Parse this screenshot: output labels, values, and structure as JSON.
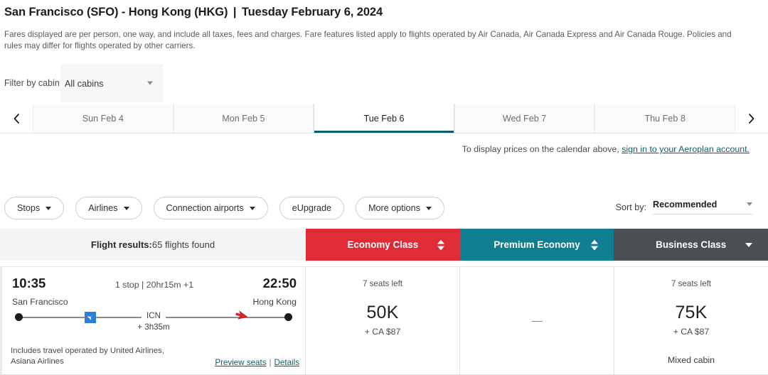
{
  "header": {
    "origin": "San Francisco (SFO)",
    "dash": "-",
    "destination": "Hong Kong (HKG)",
    "separator": "|",
    "date": "Tuesday February 6, 2024",
    "title_full": "San Francisco (SFO) - Hong Kong (HKG)  |  Tuesday February 6, 2024",
    "disclaimer": "Fares displayed are per person, one way, and include all taxes, fees and charges. Fare features listed apply to flights operated by Air Canada, Air Canada Express and Air Canada Rouge. Policies and rules may differ for flights operated by other carriers."
  },
  "cabin_filter": {
    "label": "Filter by cabin",
    "selected": "All cabins",
    "options": [
      "All cabins"
    ]
  },
  "date_strip": {
    "prev_icon": "chevron-left-icon",
    "next_icon": "chevron-right-icon",
    "tabs": [
      {
        "label": "Sun Feb 4",
        "active": false
      },
      {
        "label": "Mon Feb 5",
        "active": false
      },
      {
        "label": "Tue Feb 6",
        "active": true
      },
      {
        "label": "Wed Feb 7",
        "active": false
      },
      {
        "label": "Thu Feb 8",
        "active": false
      }
    ],
    "active_underline_color": "#0b5c6b"
  },
  "signin_note": {
    "text": "To display prices on the calendar above, ",
    "link": "sign in to your Aeroplan account.",
    "link_color": "#165c63"
  },
  "filters": {
    "pills": [
      {
        "label": "Stops",
        "has_caret": true
      },
      {
        "label": "Airlines",
        "has_caret": true
      },
      {
        "label": "Connection airports",
        "has_caret": true
      },
      {
        "label": "eUpgrade",
        "has_caret": false
      },
      {
        "label": "More options",
        "has_caret": true
      }
    ],
    "sort": {
      "label": "Sort by:",
      "value": "Recommended"
    }
  },
  "results_header": {
    "title": "Flight results:",
    "count_text": "65 flights found",
    "columns": [
      {
        "label": "Economy Class",
        "color": "#e02c36",
        "sort_control": "updown-arrows-icon"
      },
      {
        "label": "Premium Economy",
        "color": "#0f7e91",
        "sort_control": "updown-arrows-icon"
      },
      {
        "label": "Business Class",
        "color": "#4a4f52",
        "sort_control": "chevron-down-icon"
      }
    ]
  },
  "flights": [
    {
      "depart_time": "10:35",
      "arrive_time": "22:50",
      "duration_text": "1 stop | 20hr15m +1",
      "origin_city": "San Francisco",
      "destination_city": "Hong Kong",
      "stop_code": "ICN",
      "layover": "+ 3h35m",
      "operated_note": "Includes travel operated by United Airlines, Asiana Airlines",
      "preview_seats_label": "Preview seats",
      "links_divider": "|",
      "details_label": "Details",
      "fares": {
        "economy": {
          "seats_left": "7 seats left",
          "points": "50K",
          "taxes": "+ CA $87",
          "note": ""
        },
        "premium_economy": {
          "seats_left": "",
          "points": "—",
          "taxes": "",
          "note": ""
        },
        "business": {
          "seats_left": "7 seats left",
          "points": "75K",
          "taxes": "+ CA $87",
          "note": "Mixed cabin"
        }
      }
    }
  ]
}
